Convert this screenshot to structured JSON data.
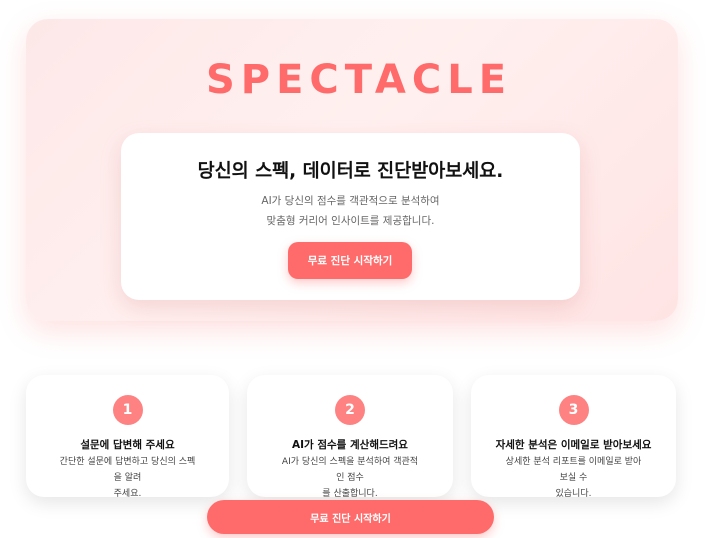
{
  "brand": {
    "name": "SPECTACLE"
  },
  "hero": {
    "title": "당신의 스펙, 데이터로 진단받아보세요.",
    "desc_line1": "AI가 당신의 점수를 객관적으로 분석하여",
    "desc_line2": "맞춤형 커리어 인사이트를 제공합니다.",
    "cta_label": "무료 진단 시작하기"
  },
  "steps": [
    {
      "number": "1",
      "title": "설문에 답변해 주세요",
      "desc_line1": "간단한 설문에 답변하고 당신의 스펙을 알려",
      "desc_line2": "주세요."
    },
    {
      "number": "2",
      "title": "AI가 점수를 계산해드려요",
      "desc_line1": "AI가 당신의 스펙을 분석하여 객관적인 점수",
      "desc_line2": "를 산출합니다."
    },
    {
      "number": "3",
      "title": "자세한 분석은 이메일로 받아보세요",
      "desc_line1": "상세한 분석 리포트를 이메일로 받아보실 수",
      "desc_line2": "있습니다."
    }
  ],
  "bottom_cta": {
    "label": "무료 진단 시작하기"
  },
  "colors": {
    "accent": "#ff6b6b",
    "badge": "#ff8282"
  }
}
